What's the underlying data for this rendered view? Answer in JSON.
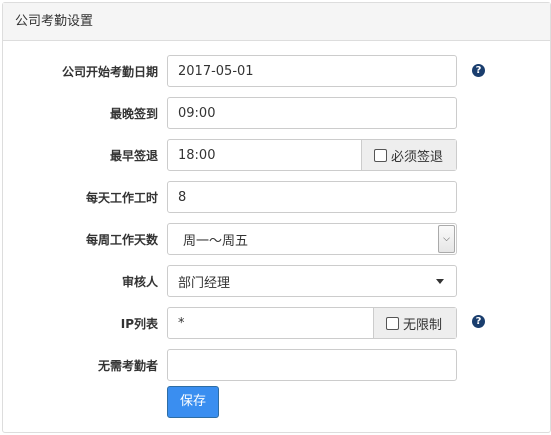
{
  "panel": {
    "title": "公司考勤设置"
  },
  "form": {
    "start_date": {
      "label": "公司开始考勤日期",
      "value": "2017-05-01"
    },
    "latest_checkin": {
      "label": "最晚签到",
      "value": "09:00"
    },
    "earliest_checkout": {
      "label": "最早签退",
      "value": "18:00",
      "addon_label": "必须签退",
      "addon_checked": false
    },
    "daily_hours": {
      "label": "每天工作工时",
      "value": "8"
    },
    "weekly_days": {
      "label": "每周工作天数",
      "selected": "周一～周五"
    },
    "approver": {
      "label": "审核人",
      "selected": "部门经理"
    },
    "ip_list": {
      "label": "IP列表",
      "value": "*",
      "addon_label": "无限制",
      "addon_checked": false
    },
    "exempt": {
      "label": "无需考勤者",
      "value": ""
    },
    "save_label": "保存"
  },
  "icons": {
    "help": "question-circle-icon",
    "help_color": "#1a3e6e"
  },
  "colors": {
    "primary_button": "#3a8ef0"
  }
}
